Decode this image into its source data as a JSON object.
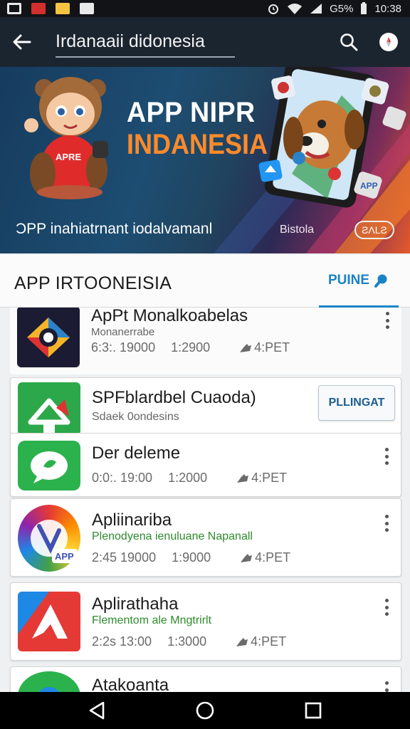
{
  "status_bar": {
    "battery": "G5%",
    "time": "10:38"
  },
  "header": {
    "search_query": "Irdanaaii didonesia"
  },
  "banner": {
    "title_line1": "APP NIPR",
    "title_line2": "INDANESIA",
    "mascot_badge": "APRE",
    "subtitle": "ƆPP inahiatrnant iodalvamanl",
    "tag": "Bistola",
    "pill": "ƧΛLƧ",
    "phone_badge": "APP"
  },
  "section": {
    "title": "APP IRTOONEISIA",
    "tab_label": "PUINE"
  },
  "apps": [
    {
      "name": "ApPt Monalkoabelas",
      "desc": "Monanerrabe",
      "meta": [
        "6:3:. 19000",
        "1:2900",
        "4:PET"
      ]
    },
    {
      "name": "SPFblardbel Cuaoda)",
      "desc": "Sdaek 0ondesins",
      "button": "PLLINGAT"
    },
    {
      "name": "Der deleme",
      "meta": [
        "0:0:. 19:00",
        "1:2000",
        "4:PET"
      ]
    },
    {
      "name": "Apliinariba",
      "desc": "Plenodyena ienuluane Napanall",
      "icon_label": "APP",
      "meta": [
        "2:45 19000",
        "1:9000",
        "4:PET"
      ]
    },
    {
      "name": "Aplirathaha",
      "desc": "Flementom ale Mngtrirlt",
      "meta": [
        "2:2s 13:00",
        "1:3000",
        "4:PET"
      ]
    },
    {
      "name": "Atakoanta"
    }
  ],
  "colors": {
    "app_bar": "#1b2530",
    "accent": "#1a83c6",
    "banner_orange": "#ff8a2a",
    "desc_green": "#2e8b2e"
  },
  "icons": [
    "back-arrow-icon",
    "search-icon",
    "compass-icon",
    "more-vert-icon",
    "thumb-icon",
    "back-nav-icon",
    "home-nav-icon",
    "recents-nav-icon"
  ]
}
